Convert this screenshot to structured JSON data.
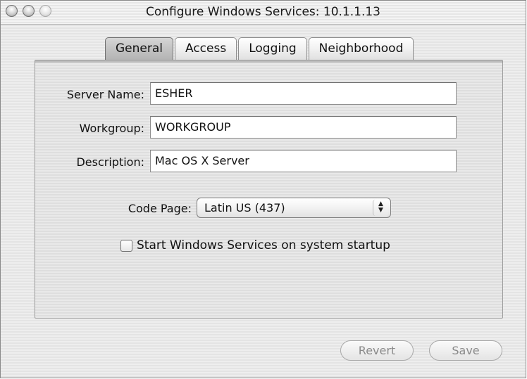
{
  "window": {
    "title": "Configure Windows Services: 10.1.1.13"
  },
  "tabs": [
    {
      "label": "General",
      "active": true
    },
    {
      "label": "Access",
      "active": false
    },
    {
      "label": "Logging",
      "active": false
    },
    {
      "label": "Neighborhood",
      "active": false
    }
  ],
  "form": {
    "server_name_label": "Server Name:",
    "server_name_value": "ESHER",
    "workgroup_label": "Workgroup:",
    "workgroup_value": "WORKGROUP",
    "description_label": "Description:",
    "description_value": "Mac OS X Server",
    "code_page_label": "Code Page:",
    "code_page_value": "Latin US (437)",
    "startup_checkbox_label": "Start Windows Services on system startup",
    "startup_checked": false
  },
  "buttons": {
    "revert_label": "Revert",
    "save_label": "Save",
    "enabled": false
  },
  "icons": {
    "window_controls": [
      "close-icon",
      "minimize-icon",
      "zoom-icon"
    ],
    "popup_arrows": "up-down-arrows-icon"
  }
}
